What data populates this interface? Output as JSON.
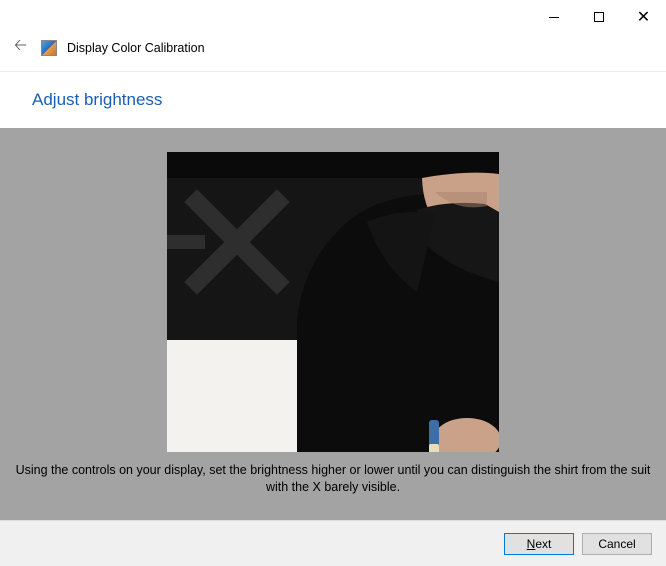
{
  "window": {
    "title": "Display Color Calibration"
  },
  "page": {
    "heading": "Adjust brightness",
    "instruction": "Using the controls on your display, set the brightness higher or lower until you can distinguish the shirt from the suit with the X barely visible."
  },
  "buttons": {
    "next_mnemonic": "N",
    "next_rest": "ext",
    "cancel": "Cancel"
  }
}
